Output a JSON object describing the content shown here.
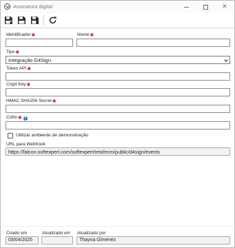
{
  "window": {
    "title": "Assinatura digital",
    "icons": {
      "app": "globe-icon",
      "minimize": "minimize-icon",
      "maximize": "maximize-icon",
      "close": "close-icon"
    }
  },
  "toolbar": {
    "buttons": [
      {
        "name": "save-new",
        "icon": "save-plus-icon"
      },
      {
        "name": "save",
        "icon": "save-icon"
      },
      {
        "name": "save-close",
        "icon": "save-close-icon"
      },
      {
        "name": "refresh",
        "icon": "refresh-icon"
      }
    ]
  },
  "form": {
    "identificador": {
      "label": "Identificador",
      "value": ""
    },
    "nome": {
      "label": "Nome",
      "value": ""
    },
    "tipo": {
      "label": "Tipo",
      "value": "Integração D4Sign"
    },
    "token_api": {
      "label": "Token API",
      "value": ""
    },
    "crypt_key": {
      "label": "Crypt Key",
      "value": ""
    },
    "hmac": {
      "label": "HMAC SHA256 Secret",
      "value": ""
    },
    "cofre": {
      "label": "Cofre",
      "value": ""
    },
    "demo": {
      "label": "Utilizar ambiente de demonstração",
      "checked": false
    },
    "webhook": {
      "label": "URL para Webhook",
      "value": "https://falcon.softexpert.com/softexpert/rest/ecm/public/d4sign/events"
    }
  },
  "footer": {
    "criado_em": {
      "label": "Criado em",
      "value": "03/04/2025"
    },
    "atualizado_em": {
      "label": "Atualizado em",
      "value": ""
    },
    "atualizado_por": {
      "label": "Atualizado por",
      "value": "Thayna Gimenez"
    }
  },
  "colors": {
    "required": "#d0202a",
    "info": "#1c6fd1",
    "border": "#8a8a8a",
    "readonly_bg": "#f2f2f2"
  }
}
